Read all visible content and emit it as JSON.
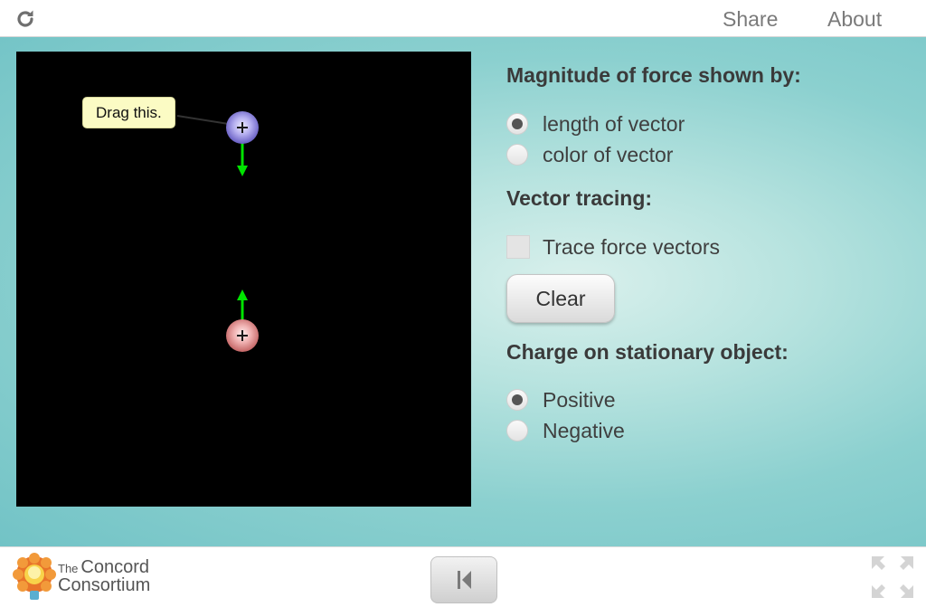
{
  "header": {
    "reload_icon": "reload-icon",
    "share_label": "Share",
    "about_label": "About"
  },
  "simulation": {
    "tooltip": "Drag this.",
    "vector_color": "#00e400",
    "mobile_charge_color": "#7d74d6",
    "stationary_charge_color": "#d98a8a"
  },
  "controls": {
    "magnitude_heading": "Magnitude of force shown by:",
    "magnitude_options": [
      {
        "label": "length of vector",
        "checked": true
      },
      {
        "label": "color of vector",
        "checked": false
      }
    ],
    "tracing_heading": "Vector tracing:",
    "trace_label": "Trace force vectors",
    "trace_checked": false,
    "clear_label": "Clear",
    "charge_heading": "Charge on stationary object:",
    "charge_options": [
      {
        "label": "Positive",
        "checked": true
      },
      {
        "label": "Negative",
        "checked": false
      }
    ]
  },
  "footer": {
    "logo_small": "The",
    "logo_line1": "Concord",
    "logo_line2": "Consortium",
    "reset_icon": "skip-back-icon",
    "fullscreen_icon": "fullscreen-icon"
  }
}
